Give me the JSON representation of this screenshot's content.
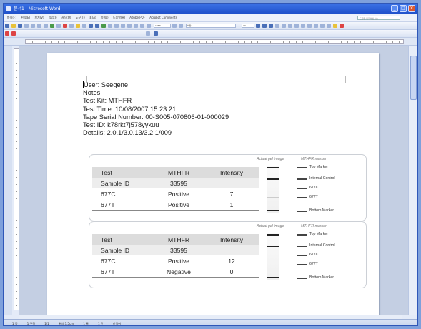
{
  "window": {
    "title": "문서1 - Microsoft Word",
    "menu_items": [
      "파일(F)",
      "편집(E)",
      "보기(V)",
      "삽입(I)",
      "서식(O)",
      "도구(T)",
      "표(A)",
      "창(W)",
      "도움말(H)",
      "Adobe PDF",
      "Acrobat Comments"
    ],
    "help_search_placeholder": "도움말 입력하십시오",
    "toolbar_zoom": "145%",
    "toolbar_style": "바탕",
    "toolbar_font_size": "10"
  },
  "document": {
    "lines": [
      "User: Seegene",
      "Notes:",
      "Test Kit: MTHFR",
      "Test Time: 10/08/2007 15:23:21",
      "Tape Serial Number: 00-S005-070806-01-000029",
      "Test ID: k78rkt7j578yykuu",
      "Details: 2.0.1/3.0.13/3.2.1/009"
    ],
    "results": [
      {
        "header": [
          "Test",
          "MTHFR",
          "Intensity"
        ],
        "rows": [
          [
            "Sample ID",
            "33595",
            ""
          ],
          [
            "677C",
            "Positive",
            "7"
          ],
          [
            "677T",
            "Positive",
            "1"
          ]
        ],
        "gel_label": "Actual gel image",
        "marker_label": "MTHFR marker",
        "markers": [
          "Top Marker",
          "Internal Control",
          "677C",
          "677T",
          "Bottom Marker"
        ]
      },
      {
        "header": [
          "Test",
          "MTHFR",
          "Intensity"
        ],
        "rows": [
          [
            "Sample ID",
            "33595",
            ""
          ],
          [
            "677C",
            "Positive",
            "12"
          ],
          [
            "677T",
            "Negative",
            "0"
          ]
        ],
        "gel_label": "Actual gel image",
        "marker_label": "MTHFR marker",
        "markers": [
          "Top Marker",
          "Internal Control",
          "677C",
          "677T",
          "Bottom Marker"
        ]
      }
    ]
  },
  "status": {
    "page": "1 쪽",
    "section": "1 구역",
    "pages": "1/1",
    "position": "위치 3,5cm",
    "line": "1 줄",
    "col": "1 칸",
    "language": "한국어"
  }
}
